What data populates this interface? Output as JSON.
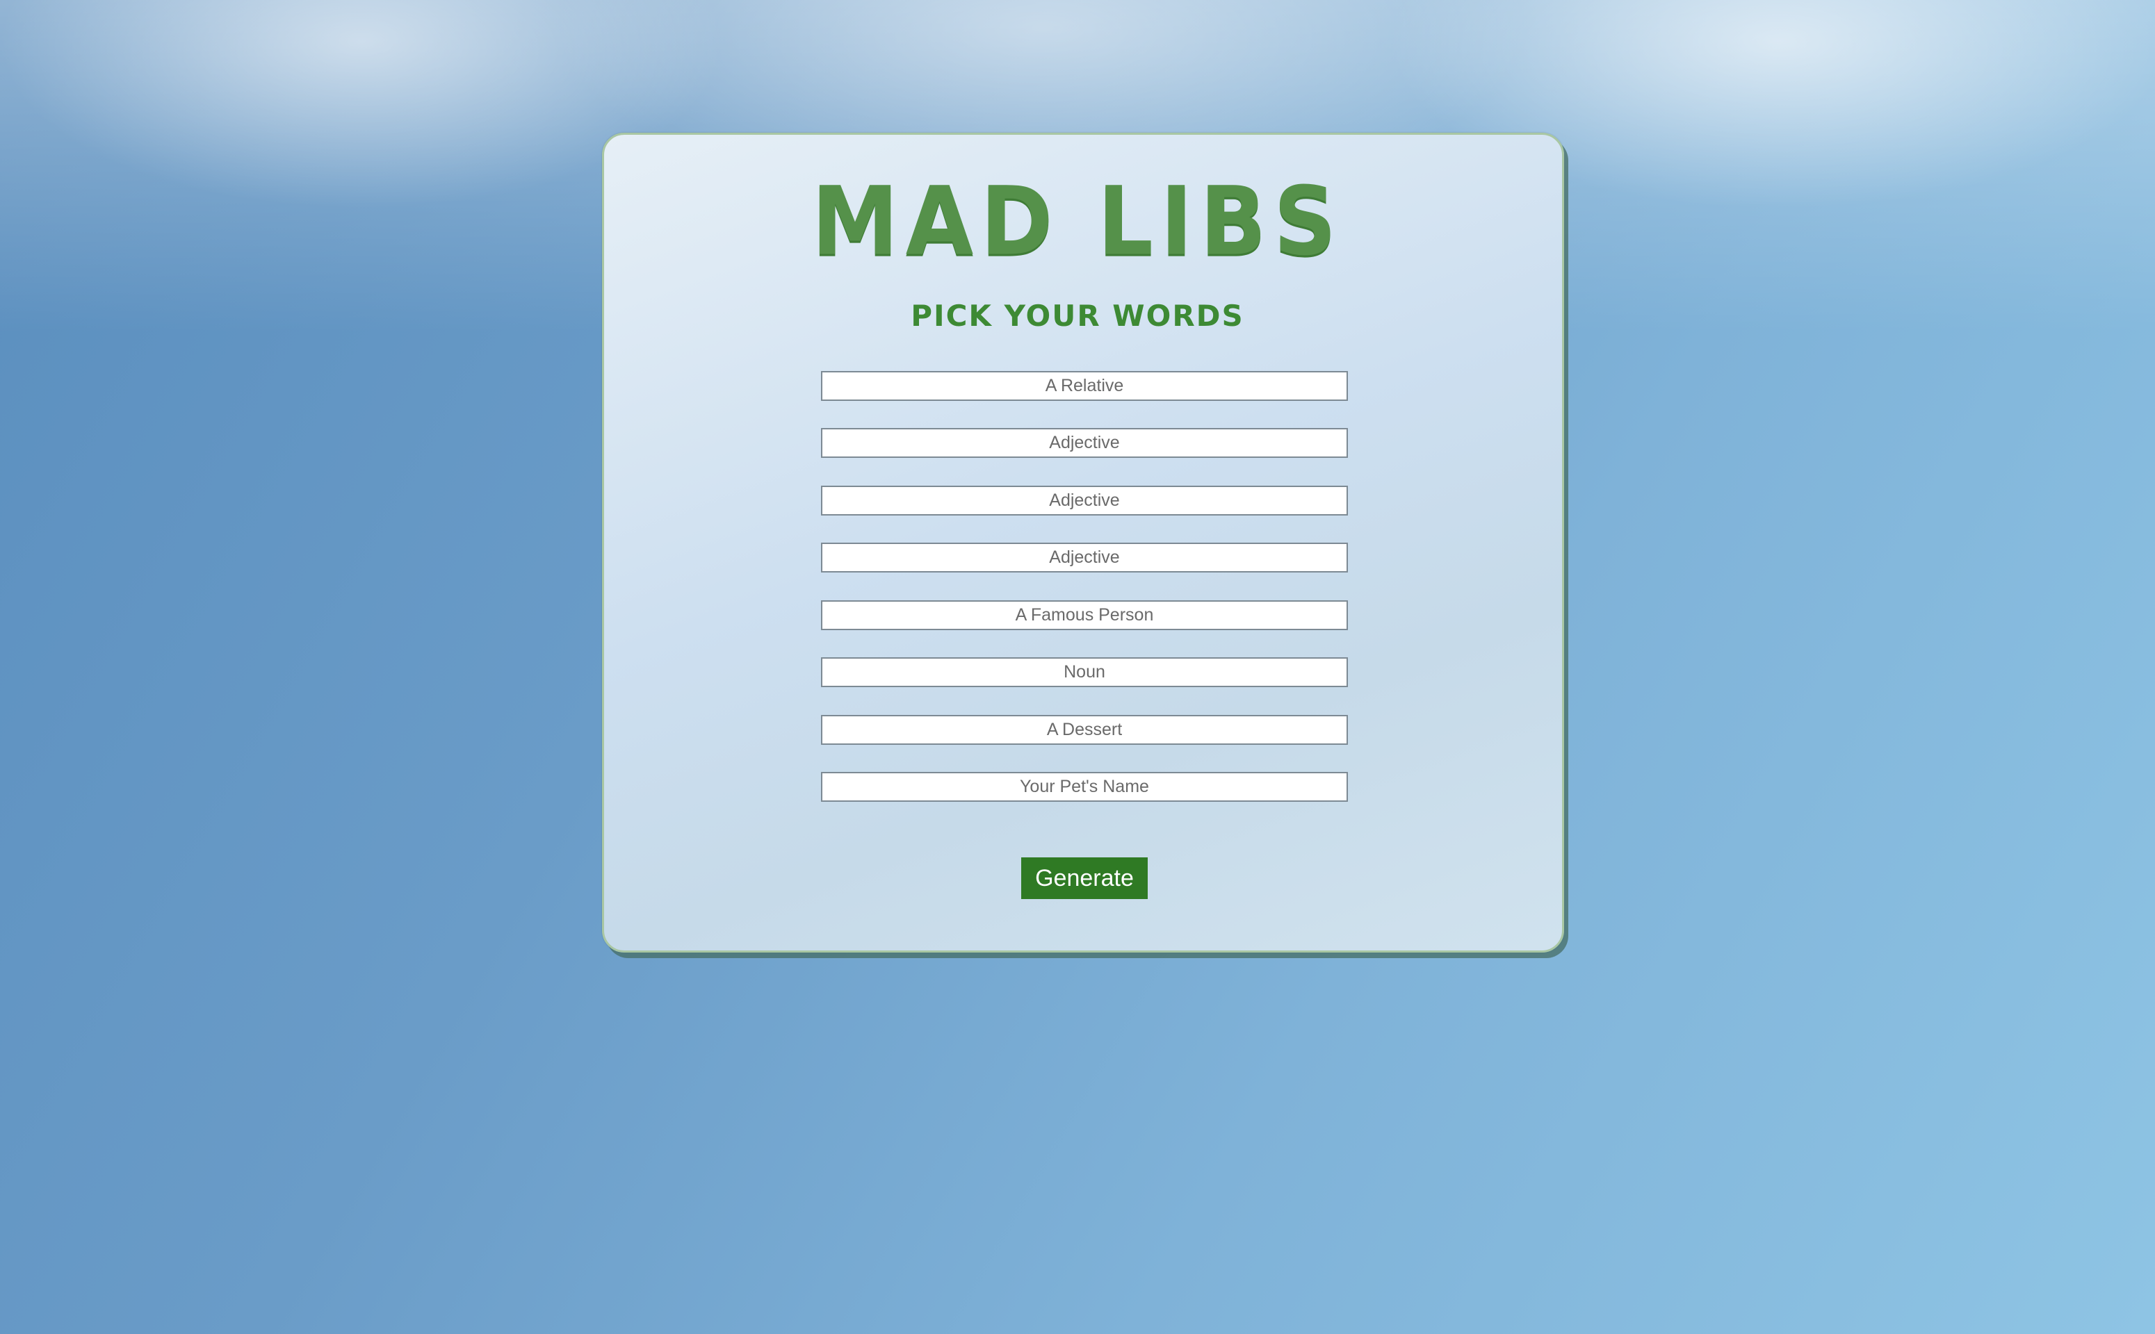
{
  "page": {
    "title": "MAD LIBS",
    "subtitle": "PICK YOUR WORDS"
  },
  "form": {
    "fields": [
      {
        "placeholder": "A Relative",
        "value": ""
      },
      {
        "placeholder": "Adjective",
        "value": ""
      },
      {
        "placeholder": "Adjective",
        "value": ""
      },
      {
        "placeholder": "Adjective",
        "value": ""
      },
      {
        "placeholder": "A Famous Person",
        "value": ""
      },
      {
        "placeholder": "Noun",
        "value": ""
      },
      {
        "placeholder": "A Dessert",
        "value": ""
      },
      {
        "placeholder": "Your Pet's Name",
        "value": ""
      }
    ],
    "submit_label": "Generate"
  },
  "colors": {
    "accent_green": "#2f7a24",
    "title_green": "#55914a",
    "card_border": "#a9c7a3"
  }
}
